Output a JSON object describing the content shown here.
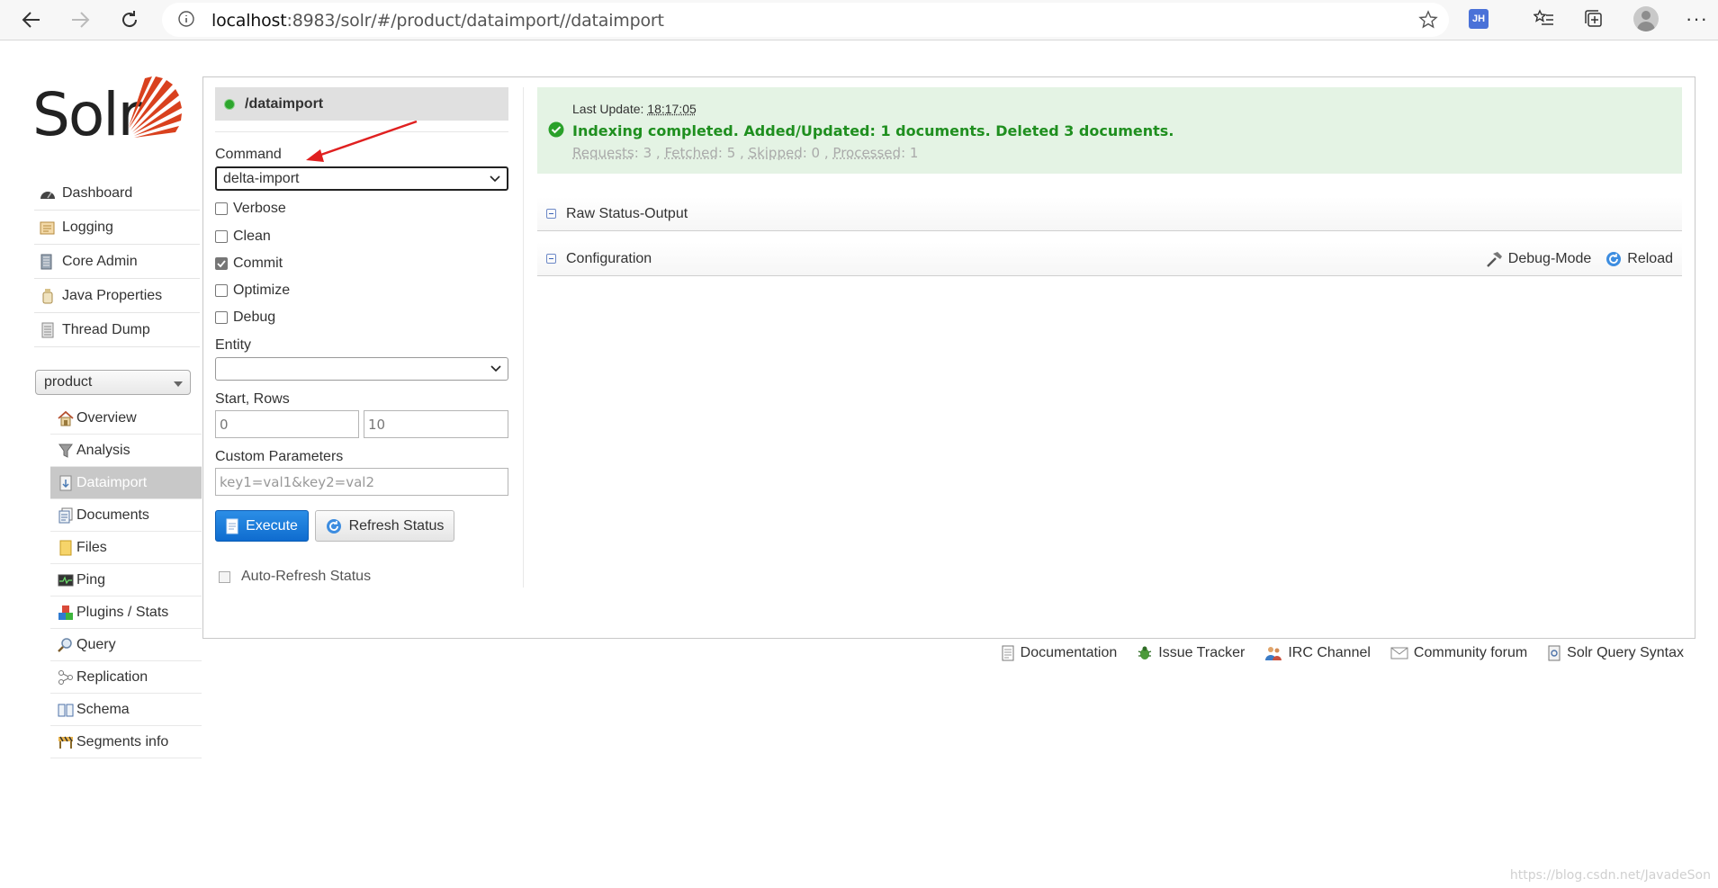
{
  "browser": {
    "url_host": "localhost",
    "url_rest": ":8983/solr/#/product/dataimport//dataimport",
    "extension_badge": "JH"
  },
  "sidebar": {
    "logo_text": "Solr",
    "items": [
      {
        "label": "Dashboard",
        "icon": "dashboard-icon"
      },
      {
        "label": "Logging",
        "icon": "logging-icon"
      },
      {
        "label": "Core Admin",
        "icon": "core-admin-icon"
      },
      {
        "label": "Java Properties",
        "icon": "java-properties-icon"
      },
      {
        "label": "Thread Dump",
        "icon": "thread-dump-icon"
      }
    ],
    "core_selector": "product",
    "core_items": [
      {
        "label": "Overview",
        "icon": "home-icon"
      },
      {
        "label": "Analysis",
        "icon": "funnel-icon"
      },
      {
        "label": "Dataimport",
        "icon": "dataimport-icon",
        "active": true
      },
      {
        "label": "Documents",
        "icon": "documents-icon"
      },
      {
        "label": "Files",
        "icon": "folder-icon"
      },
      {
        "label": "Ping",
        "icon": "ping-icon"
      },
      {
        "label": "Plugins / Stats",
        "icon": "plugins-icon"
      },
      {
        "label": "Query",
        "icon": "query-icon"
      },
      {
        "label": "Replication",
        "icon": "replication-icon"
      },
      {
        "label": "Schema",
        "icon": "schema-icon"
      },
      {
        "label": "Segments info",
        "icon": "segments-icon"
      }
    ]
  },
  "form": {
    "handler": "/dataimport",
    "command_label": "Command",
    "command_value": "delta-import",
    "options": [
      {
        "label": "Verbose",
        "checked": false
      },
      {
        "label": "Clean",
        "checked": false
      },
      {
        "label": "Commit",
        "checked": true
      },
      {
        "label": "Optimize",
        "checked": false
      },
      {
        "label": "Debug",
        "checked": false
      }
    ],
    "entity_label": "Entity",
    "entity_value": "",
    "start_rows_label": "Start, Rows",
    "start_value": "0",
    "rows_value": "10",
    "custom_params_label": "Custom Parameters",
    "custom_params_placeholder": "key1=val1&key2=val2",
    "execute_label": "Execute",
    "refresh_label": "Refresh Status",
    "auto_refresh_label": "Auto-Refresh Status"
  },
  "status": {
    "last_update_label": "Last Update:",
    "last_update_time": "18:17:05",
    "message": "Indexing completed. Added/Updated: 1 documents. Deleted 3 documents.",
    "requests_label": "Requests",
    "requests": "3",
    "fetched_label": "Fetched",
    "fetched": "5",
    "skipped_label": "Skipped",
    "skipped": "0",
    "processed_label": "Processed",
    "processed": "1",
    "status_color": "#1f8f1f"
  },
  "panels": {
    "raw_status_label": "Raw Status-Output",
    "configuration_label": "Configuration",
    "debug_mode_label": "Debug-Mode",
    "reload_label": "Reload"
  },
  "footer": {
    "links": [
      {
        "label": "Documentation",
        "icon": "documentation-icon"
      },
      {
        "label": "Issue Tracker",
        "icon": "bug-icon"
      },
      {
        "label": "IRC Channel",
        "icon": "irc-icon"
      },
      {
        "label": "Community forum",
        "icon": "mail-icon"
      },
      {
        "label": "Solr Query Syntax",
        "icon": "syntax-icon"
      }
    ]
  },
  "watermark": "https://blog.csdn.net/JavadeSon"
}
